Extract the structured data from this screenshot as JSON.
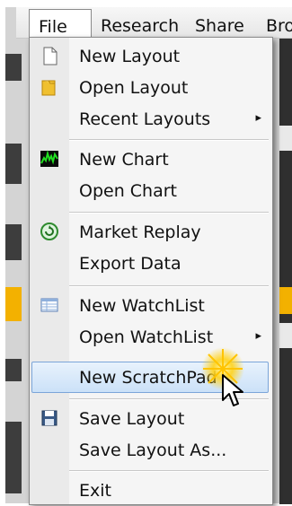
{
  "menubar": {
    "items": [
      "File",
      "Research",
      "Share",
      "Bro"
    ]
  },
  "file_menu": {
    "items": [
      {
        "label": "New Layout",
        "icon": "document-icon"
      },
      {
        "label": "Open Layout",
        "icon": "folder-icon"
      },
      {
        "label": "Recent Layouts",
        "submenu": true,
        "arrow": "▸"
      },
      {
        "label": "New Chart",
        "icon": "chart-icon"
      },
      {
        "label": "Open Chart"
      },
      {
        "label": "Market Replay",
        "icon": "replay-icon"
      },
      {
        "label": "Export Data"
      },
      {
        "label": "New WatchList",
        "icon": "watchlist-icon"
      },
      {
        "label": "Open WatchList",
        "submenu": true,
        "arrow": "▸"
      },
      {
        "label": "New ScratchPad",
        "highlighted": true
      },
      {
        "label": "Save Layout",
        "icon": "save-icon"
      },
      {
        "label": "Save Layout As..."
      },
      {
        "label": "Exit"
      }
    ]
  },
  "colors": {
    "highlight_bg": "#cbe1f8",
    "highlight_border": "#7ba5d9",
    "background_accent": "#f3b100",
    "glow": "#ffd21a"
  }
}
